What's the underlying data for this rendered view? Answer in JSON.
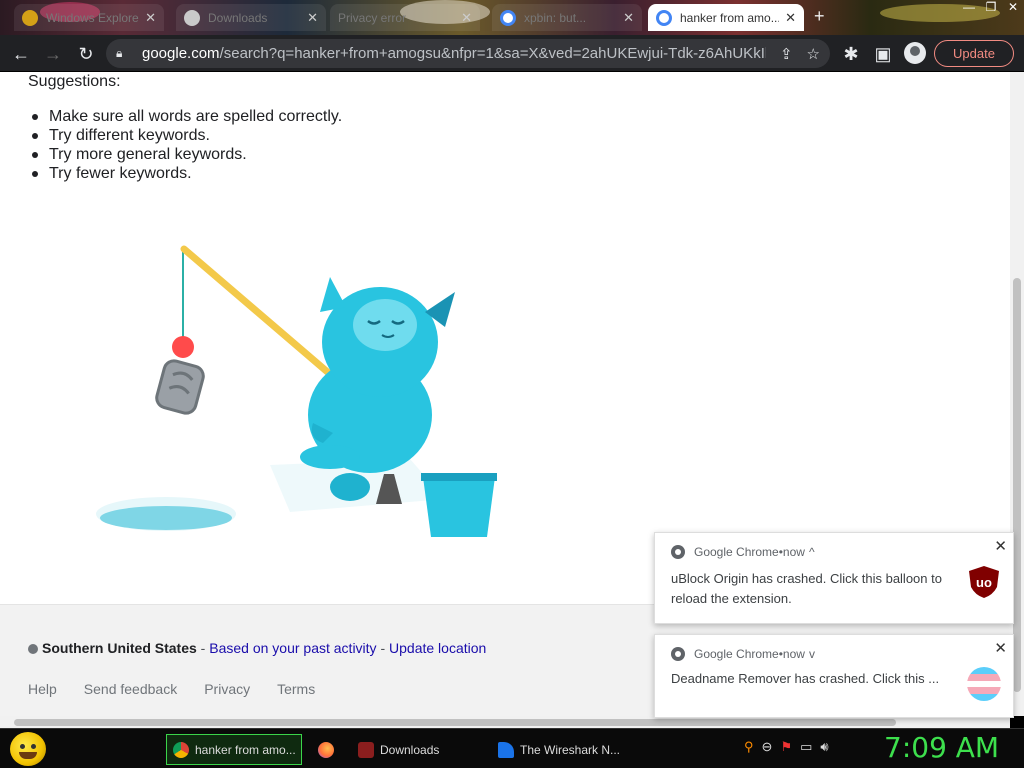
{
  "browser": {
    "tabs": [
      {
        "title": "Windows Explorer",
        "favicon_color": "#d4a017",
        "active": false
      },
      {
        "title": "Downloads",
        "favicon_color": "#c9c9c9",
        "active": false
      },
      {
        "title": "Privacy error",
        "favicon_color": "#c9c9c9",
        "active": false
      },
      {
        "title": "xpbin: but...",
        "favicon_color": "#4285f4",
        "active": false
      },
      {
        "title": "hanker from amo...",
        "favicon_color": "#4285f4",
        "active": true
      }
    ],
    "new_tab_icon": "plus-icon",
    "window_controls": [
      "—",
      "❐",
      "✕"
    ],
    "url_host": "google.com",
    "url_path": "/search?q=hanker+from+amogsu&nfpr=1&sa=X&ved=2ahUKEwjui-Tdk-z6AhUKkIkE...",
    "update_label": "Update"
  },
  "suggestions": {
    "title": "Suggestions:",
    "items": [
      "Make sure all words are spelled correctly.",
      "Try different keywords.",
      "Try more general keywords.",
      "Try fewer keywords."
    ]
  },
  "footer": {
    "location_name": "Southern United States",
    "sep1": " - ",
    "based_on": "Based on your past activity",
    "sep2": " - ",
    "update_location": "Update location",
    "links": [
      "Help",
      "Send feedback",
      "Privacy",
      "Terms"
    ]
  },
  "notifications": [
    {
      "app": "Google Chrome",
      "time": "now",
      "chevron": "^",
      "body": "uBlock Origin has crashed. Click this balloon to reload the extension.",
      "icon": "ublock-origin-icon"
    },
    {
      "app": "Google Chrome",
      "time": "now",
      "chevron": "v",
      "body": "Deadname Remover has crashed. Click this ...",
      "icon": "transgender-flag-icon"
    }
  ],
  "notification_separator": " • ",
  "taskbar": {
    "items": [
      {
        "label": "hanker from amo...",
        "icon_color": "#4285f4",
        "active": true
      },
      {
        "label": "",
        "icon_color": "#ff7139",
        "active": false
      },
      {
        "label": "Downloads",
        "icon_color": "#8b1e1e",
        "active": false
      },
      {
        "label": "The Wireshark N...",
        "icon_color": "#1a73e8",
        "active": false
      }
    ],
    "clock": "7:09 AM",
    "accent": "#3de04d"
  }
}
